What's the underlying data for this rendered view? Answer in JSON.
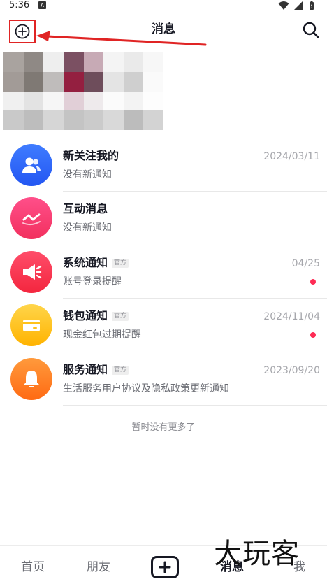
{
  "status_bar": {
    "time": "5:36",
    "notif_letter": "A"
  },
  "header": {
    "title": "消息",
    "add_icon": "plus-circle-icon",
    "search_icon": "search-icon"
  },
  "messages": [
    {
      "title": "新关注我的",
      "subtitle": "没有新通知",
      "date": "2024/03/11",
      "official": "",
      "unread": false,
      "icon": "people-icon",
      "color_top": "#3f7cff",
      "color_bottom": "#2356f2"
    },
    {
      "title": "互动消息",
      "subtitle": "没有新通知",
      "date": "",
      "official": "",
      "unread": false,
      "icon": "chat-wave-icon",
      "color_top": "#ff4f8a",
      "color_bottom": "#f2305e"
    },
    {
      "title": "系统通知",
      "subtitle": "账号登录提醒",
      "date": "04/25",
      "official": "官方",
      "unread": true,
      "icon": "megaphone-icon",
      "color_top": "#ff4d6a",
      "color_bottom": "#f3263e"
    },
    {
      "title": "钱包通知",
      "subtitle": "现金红包过期提醒",
      "date": "2024/11/04",
      "official": "官方",
      "unread": true,
      "icon": "wallet-card-icon",
      "color_top": "#ffd54a",
      "color_bottom": "#ffb300"
    },
    {
      "title": "服务通知",
      "subtitle": "生活服务用户协议及隐私政策更新通知",
      "date": "2023/09/20",
      "official": "官方",
      "unread": false,
      "icon": "bell-icon",
      "color_top": "#ff9a3c",
      "color_bottom": "#ff6a13"
    }
  ],
  "no_more_text": "暂时没有更多了",
  "bottom_nav": {
    "home": "首页",
    "friends": "朋友",
    "messages": "消息",
    "me": "我"
  },
  "watermark": "大玩客",
  "colors": {
    "accent_red": "#fe2c55",
    "annotation_red": "#e02424"
  }
}
